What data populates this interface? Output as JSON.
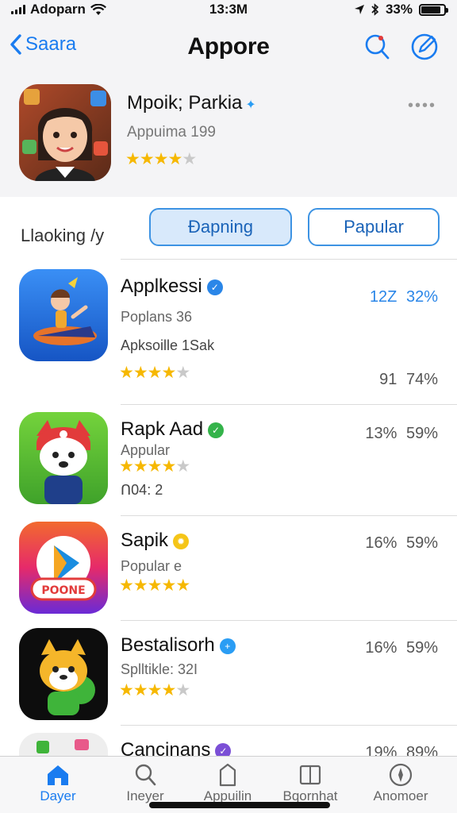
{
  "status": {
    "carrier": "Adoparn",
    "time": "13:3M",
    "battery": "33%",
    "battery_level": 0.85
  },
  "nav": {
    "back_label": "Saara",
    "title": "Appore",
    "icons": [
      "search-icon",
      "compose-icon"
    ]
  },
  "featured": {
    "name": "Mpoik; Parkia",
    "subtitle": "Appuima 199",
    "rating": 4,
    "more": "••••"
  },
  "filter": {
    "label": "Llaoking /y",
    "segments": [
      {
        "label": "Ðapning",
        "active": true
      },
      {
        "label": "Papular",
        "active": false
      }
    ]
  },
  "apps": [
    {
      "name": "Applkessi",
      "badge_color": "#2a86e8",
      "badge_glyph": "✓",
      "line1": "Poplans 36",
      "line2": "Apksoille 1Sak",
      "rating": 4,
      "stat_top": "12Z 32%",
      "stat_bottom": "91 74%"
    },
    {
      "name": "Rapk Aad",
      "badge_color": "#34b34a",
      "badge_glyph": "✓",
      "line1": "Appular",
      "line2": "ᑎ04: 2",
      "rating": 4,
      "stat_top": "13% 59%",
      "stat_bottom": ""
    },
    {
      "name": "Sapik",
      "badge_color": "#f5c518",
      "badge_glyph": "✹",
      "line1": "Popular e",
      "line2": "",
      "rating": 5,
      "stat_top": "16% 59%",
      "stat_bottom": ""
    },
    {
      "name": "Bestalisorh",
      "badge_color": "#2a9df4",
      "badge_glyph": "+",
      "line1": "Splltikle: 32I",
      "line2": "",
      "rating": 4,
      "stat_top": "16% 59%",
      "stat_bottom": ""
    },
    {
      "name": "Cancinans",
      "badge_color": "#7b4fd6",
      "badge_glyph": "✓",
      "line1": "",
      "line2": "",
      "rating": 0,
      "stat_top": "19% 89%",
      "stat_bottom": ""
    }
  ],
  "tabs": [
    {
      "label": "Dayer",
      "icon": "home-icon",
      "active": true
    },
    {
      "label": "Ineyer",
      "icon": "search-icon",
      "active": false
    },
    {
      "label": "Appuilin",
      "icon": "apps-icon",
      "active": false
    },
    {
      "label": "Bqornhat",
      "icon": "book-icon",
      "active": false
    },
    {
      "label": "Anomoer",
      "icon": "compass-icon",
      "active": false
    }
  ]
}
